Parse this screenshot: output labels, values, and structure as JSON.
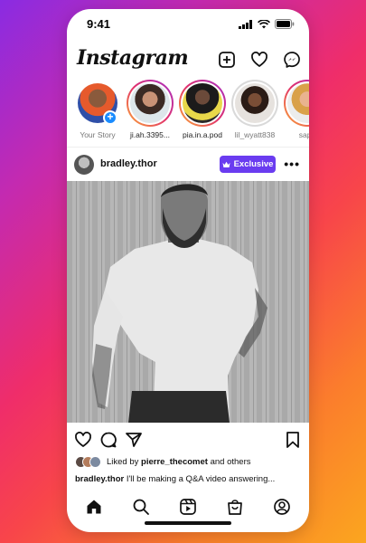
{
  "status_bar": {
    "time": "9:41"
  },
  "header": {
    "logo": "Instagram",
    "icons": [
      "new-post-icon",
      "heart-icon",
      "messenger-icon"
    ]
  },
  "stories": [
    {
      "label": "Your Story",
      "own": true
    },
    {
      "label": "ji.ah.3395..."
    },
    {
      "label": "pia.in.a.pod"
    },
    {
      "label": "lil_wyatt838",
      "seen": true
    },
    {
      "label": "sapp"
    }
  ],
  "post": {
    "username": "bradley.thor",
    "badge": "Exclusive",
    "likes": {
      "prefix": "Liked by ",
      "user": "pierre_thecomet",
      "suffix": " and others"
    },
    "caption": {
      "user": "bradley.thor",
      "text": " I'll be making a Q&A video answering..."
    }
  },
  "bottom_nav": [
    "home-icon",
    "search-icon",
    "reels-icon",
    "shop-icon",
    "profile-icon"
  ],
  "colors": {
    "exclusive_badge": "#6a3cf0",
    "add_story_badge": "#1a8cff"
  }
}
